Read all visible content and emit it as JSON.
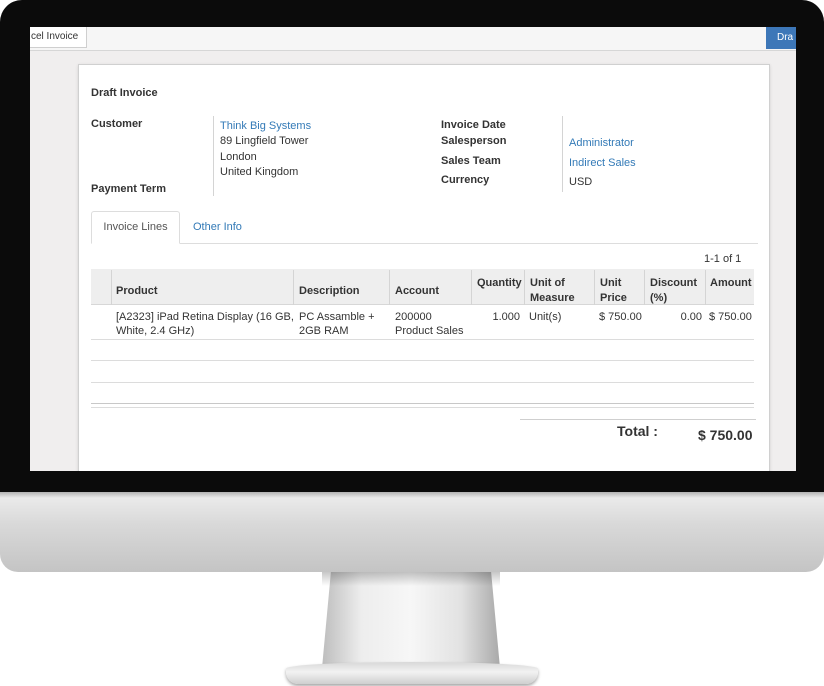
{
  "toolbar": {
    "cancel_label": "cel Invoice",
    "draft_label": "Dra"
  },
  "invoice": {
    "title": "Draft Invoice",
    "customer_label": "Customer",
    "customer_name": "Think Big Systems",
    "address_line1": "89 Lingfield Tower",
    "address_line2": "London",
    "address_line3": "United Kingdom",
    "payment_term_label": "Payment Term",
    "invoice_date_label": "Invoice Date",
    "salesperson_label": "Salesperson",
    "salesperson_value": "Administrator",
    "sales_team_label": "Sales Team",
    "sales_team_value": "Indirect Sales",
    "currency_label": "Currency",
    "currency_value": "USD"
  },
  "tabs": [
    {
      "label": "Invoice Lines",
      "active": true
    },
    {
      "label": "Other Info",
      "active": false
    }
  ],
  "pager": "1-1 of 1",
  "table": {
    "columns": {
      "product": "Product",
      "description": "Description",
      "account": "Account",
      "quantity": "Quantity",
      "uom_line1": "Unit of",
      "uom_line2": "Measure",
      "price_line1": "Unit",
      "price_line2": "Price",
      "discount_line1": "Discount",
      "discount_line2": "(%)",
      "amount": "Amount"
    },
    "rows": [
      {
        "product_line1": "[A2323] iPad Retina Display (16 GB,",
        "product_line2": "White, 2.4 GHz)",
        "description_line1": "PC Assamble +",
        "description_line2": "2GB RAM",
        "account_line1": "200000",
        "account_line2": "Product Sales",
        "quantity": "1.000",
        "uom": "Unit(s)",
        "unit_price": "$ 750.00",
        "discount": "0.00",
        "amount": "$ 750.00"
      }
    ]
  },
  "total": {
    "label": "Total :",
    "value": "$ 750.00"
  }
}
